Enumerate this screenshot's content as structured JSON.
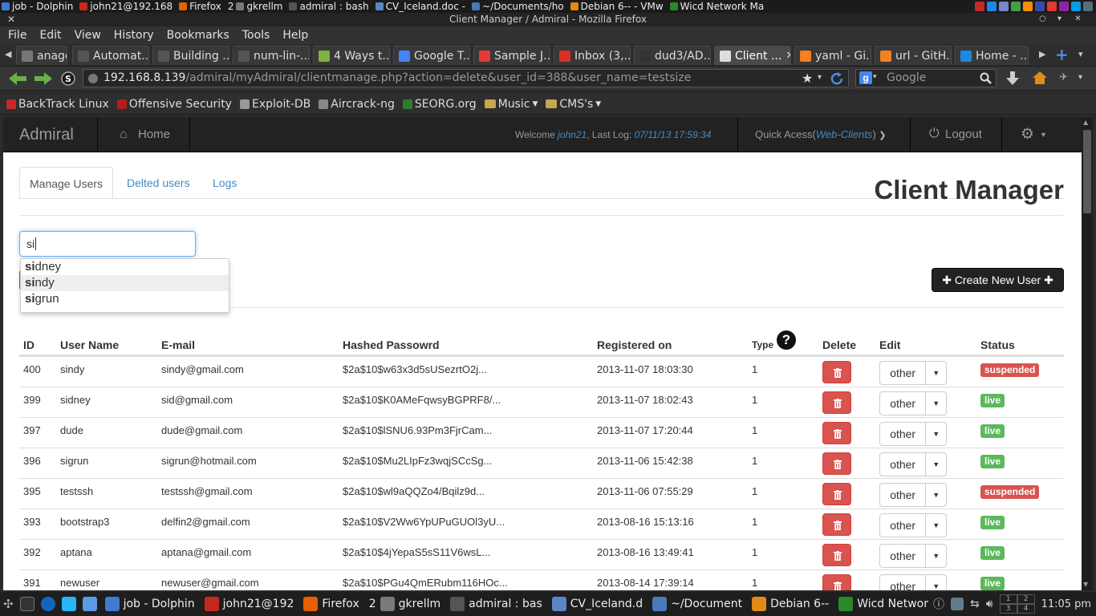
{
  "top_panel": {
    "items": [
      {
        "label": "job - Dolphin",
        "color": "#3f7bd0"
      },
      {
        "label": "john21@192.168",
        "color": "#c4291e"
      },
      {
        "label": "Firefox",
        "color": "#e66000"
      },
      {
        "label": "gkrellm",
        "prefix": "2",
        "color": "#7a7a7a"
      },
      {
        "label": "admiral : bash",
        "color": "#555555"
      },
      {
        "label": "CV_Iceland.doc -",
        "color": "#5a86c5"
      },
      {
        "label": "~/Documents/ho",
        "color": "#4a7ab8"
      },
      {
        "label": "Debian 6-- - VMw",
        "color": "#e08a18"
      },
      {
        "label": "Wicd Network Ma",
        "color": "#2a8a2a"
      }
    ]
  },
  "window": {
    "title": "Client Manager / Admiral - Mozilla Firefox",
    "close_glyph": "✕",
    "btns": [
      "○",
      "▾",
      "✕"
    ]
  },
  "menu": [
    "File",
    "Edit",
    "View",
    "History",
    "Bookmarks",
    "Tools",
    "Help"
  ],
  "tabs": [
    {
      "label": "anage...",
      "color": "#777777"
    },
    {
      "label": "Automat...",
      "color": "#555555"
    },
    {
      "label": "Building ...",
      "color": "#555555"
    },
    {
      "label": "num-lin-...",
      "color": "#555555"
    },
    {
      "label": "4 Ways t...",
      "color": "#7cb342"
    },
    {
      "label": "Google T...",
      "color": "#4285f4"
    },
    {
      "label": "Sample J...",
      "color": "#e53935"
    },
    {
      "label": "Inbox (3,...",
      "color": "#d93025"
    },
    {
      "label": "dud3/AD...",
      "color": "#333333"
    },
    {
      "label": "Client ...",
      "color": "#dddddd",
      "active": true
    },
    {
      "label": "yaml - Gi...",
      "color": "#f48024"
    },
    {
      "label": "url - GitH...",
      "color": "#f48024"
    },
    {
      "label": "Home - ...",
      "color": "#1e88e5"
    }
  ],
  "url": {
    "host": "192.168.8.139",
    "path": "/admiral/myAdmiral/clientmanage.php?action=delete&user_id=388&user_name=testsize",
    "search_placeholder": "Google"
  },
  "bookmarks": [
    {
      "label": "BackTrack Linux",
      "color": "#c62828"
    },
    {
      "label": "Offensive Security",
      "color": "#b71c1c"
    },
    {
      "label": "Exploit-DB",
      "color": "#999999"
    },
    {
      "label": "Aircrack-ng",
      "color": "#888888"
    },
    {
      "label": "SEORG.org",
      "color": "#2e7d32"
    },
    {
      "label": "Music",
      "folder": true,
      "color": "#c8a650"
    },
    {
      "label": "CMS's",
      "folder": true,
      "color": "#c8a650"
    }
  ],
  "navbar": {
    "brand": "Admiral",
    "home": "Home",
    "welcome_prefix": "Welcome",
    "user": "john21",
    "last_log_label": ", Last Log:",
    "last_log": "07/11/13 17:59:34",
    "quick_access_label": "Quick Acess",
    "quick_access_link": "Web-Clients",
    "logout": "Logout"
  },
  "content": {
    "tabs": [
      "Manage Users",
      "Delted users",
      "Logs"
    ],
    "heading": "Client Manager",
    "search_value": "si",
    "autocomplete": [
      {
        "match": "si",
        "rest": "dney"
      },
      {
        "match": "si",
        "rest": "ndy"
      },
      {
        "match": "si",
        "rest": "grun"
      }
    ],
    "create_button": "Create New User",
    "columns": [
      "ID",
      "User Name",
      "E-mail",
      "Hashed Passowrd",
      "Registered on",
      "Type",
      "Delete",
      "Edit",
      "Status"
    ],
    "edit_label": "other",
    "rows": [
      {
        "id": "400",
        "user": "sindy",
        "email": "sindy@gmail.com",
        "hash": "$2a$10$w63x3d5sUSezrtO2j...",
        "registered": "2013-11-07 18:03:30",
        "type": "1",
        "status": "suspended"
      },
      {
        "id": "399",
        "user": "sidney",
        "email": "sid@gmail.com",
        "hash": "$2a$10$K0AMeFqwsyBGPRF8/...",
        "registered": "2013-11-07 18:02:43",
        "type": "1",
        "status": "live"
      },
      {
        "id": "397",
        "user": "dude",
        "email": "dude@gmail.com",
        "hash": "$2a$10$lSNU6.93Pm3FjrCam...",
        "registered": "2013-11-07 17:20:44",
        "type": "1",
        "status": "live"
      },
      {
        "id": "396",
        "user": "sigrun",
        "email": "sigrun@hotmail.com",
        "hash": "$2a$10$Mu2LIpFz3wqjSCcSg...",
        "registered": "2013-11-06 15:42:38",
        "type": "1",
        "status": "live"
      },
      {
        "id": "395",
        "user": "testssh",
        "email": "testssh@gmail.com",
        "hash": "$2a$10$wl9aQQZo4/Bqilz9d...",
        "registered": "2013-11-06 07:55:29",
        "type": "1",
        "status": "suspended"
      },
      {
        "id": "393",
        "user": "bootstrap3",
        "email": "delfin2@gmail.com",
        "hash": "$2a$10$V2Ww6YpUPuGUOl3yU...",
        "registered": "2013-08-16 15:13:16",
        "type": "1",
        "status": "live"
      },
      {
        "id": "392",
        "user": "aptana",
        "email": "aptana@gmail.com",
        "hash": "$2a$10$4jYepaS5sS11V6wsL...",
        "registered": "2013-08-16 13:49:41",
        "type": "1",
        "status": "live"
      },
      {
        "id": "391",
        "user": "newuser",
        "email": "newuser@gmail.com",
        "hash": "$2a$10$PGu4QmERubm116HOc...",
        "registered": "2013-08-14 17:39:14",
        "type": "1",
        "status": "live"
      }
    ],
    "status_colors": {
      "suspended": "#d9534f",
      "live": "#5cb85c"
    }
  },
  "taskbar": {
    "items": [
      {
        "label": "job - Dolphin",
        "color": "#3f7bd0"
      },
      {
        "label": "john21@192",
        "color": "#c4291e"
      },
      {
        "label": "Firefox",
        "color": "#e66000"
      },
      {
        "label": "gkrellm",
        "prefix": "2",
        "color": "#7a7a7a"
      },
      {
        "label": "admiral : bas",
        "color": "#555555"
      },
      {
        "label": "CV_Iceland.d",
        "color": "#5a86c5"
      },
      {
        "label": "~/Document",
        "color": "#4a7ab8"
      },
      {
        "label": "Debian 6--",
        "color": "#e08a18"
      },
      {
        "label": "Wicd Networ",
        "color": "#2a8a2a"
      }
    ],
    "pager": [
      "1",
      "2",
      "3",
      "4"
    ],
    "clock": "11:05 pm"
  }
}
